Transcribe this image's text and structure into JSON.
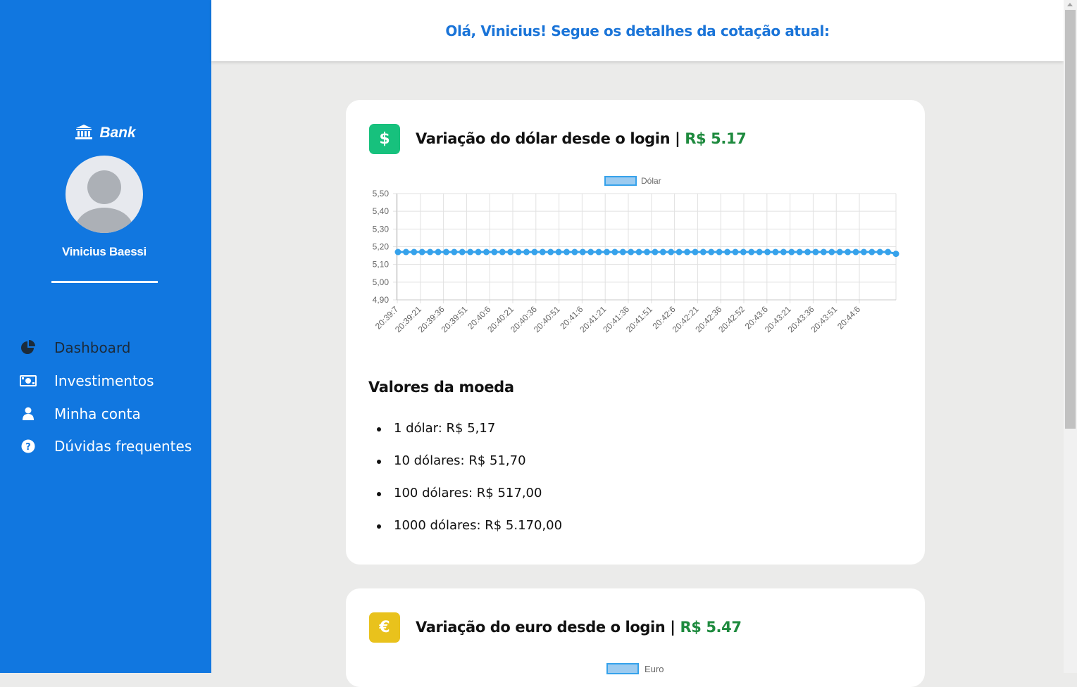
{
  "sidebar": {
    "brand": "Bank",
    "user_name": "Vinicius Baessi",
    "nav": [
      {
        "label": "Dashboard",
        "icon": "pie-chart-icon",
        "active": true
      },
      {
        "label": "Investimentos",
        "icon": "money-bill-icon",
        "active": false
      },
      {
        "label": "Minha conta",
        "icon": "user-icon",
        "active": false
      },
      {
        "label": "Dúvidas frequentes",
        "icon": "question-circle-icon",
        "active": false
      }
    ]
  },
  "header": {
    "greeting": "Olá, Vinicius! Segue os detalhes da cotação atual:"
  },
  "usd_card": {
    "badge": "$",
    "title": "Variação do dólar desde o login",
    "separator": "|",
    "price": "R$ 5.17",
    "section_title": "Valores da moeda",
    "values": [
      "1 dólar: R$ 5,17",
      "10 dólares: R$ 51,70",
      "100 dólares: R$ 517,00",
      "1000 dólares: R$ 5.170,00"
    ]
  },
  "eur_card": {
    "badge": "€",
    "title": "Variação do euro desde o login",
    "separator": "|",
    "price": "R$ 5.47",
    "legend": "Euro"
  },
  "colors": {
    "sidebar": "#1177e0",
    "accent_text": "#1a74d8",
    "price_green": "#1e8a3e",
    "usd_badge": "#17c17d",
    "eur_badge": "#e9c21c",
    "series_line": "#36a2eb"
  },
  "chart_data": {
    "type": "line",
    "legend": [
      "Dólar"
    ],
    "ylim": [
      4.9,
      5.5
    ],
    "y_ticks": [
      "5,50",
      "5,40",
      "5,30",
      "5,20",
      "5,10",
      "5,00",
      "4,90"
    ],
    "x_tick_labels": [
      "20:39:7",
      "20:39:21",
      "20:39:36",
      "20:39:51",
      "20:40:6",
      "20:40:21",
      "20:40:36",
      "20:40:51",
      "20:41:6",
      "20:41:21",
      "20:41:36",
      "20:41:51",
      "20:42:6",
      "20:42:21",
      "20:42:36",
      "20:42:52",
      "20:43:6",
      "20:43:21",
      "20:43:36",
      "20:43:51",
      "20:44:6"
    ],
    "grid": true,
    "series": [
      {
        "name": "Dólar",
        "values": [
          5.17,
          5.17,
          5.17,
          5.17,
          5.17,
          5.17,
          5.17,
          5.17,
          5.17,
          5.17,
          5.17,
          5.17,
          5.17,
          5.17,
          5.17,
          5.17,
          5.17,
          5.17,
          5.17,
          5.17,
          5.17,
          5.17,
          5.17,
          5.17,
          5.17,
          5.17,
          5.17,
          5.17,
          5.17,
          5.17,
          5.17,
          5.17,
          5.17,
          5.17,
          5.17,
          5.17,
          5.17,
          5.17,
          5.17,
          5.17,
          5.17,
          5.17,
          5.17,
          5.17,
          5.17,
          5.17,
          5.17,
          5.17,
          5.17,
          5.17,
          5.17,
          5.17,
          5.17,
          5.17,
          5.17,
          5.17,
          5.17,
          5.17,
          5.17,
          5.17,
          5.17,
          5.17,
          5.16
        ]
      }
    ]
  }
}
